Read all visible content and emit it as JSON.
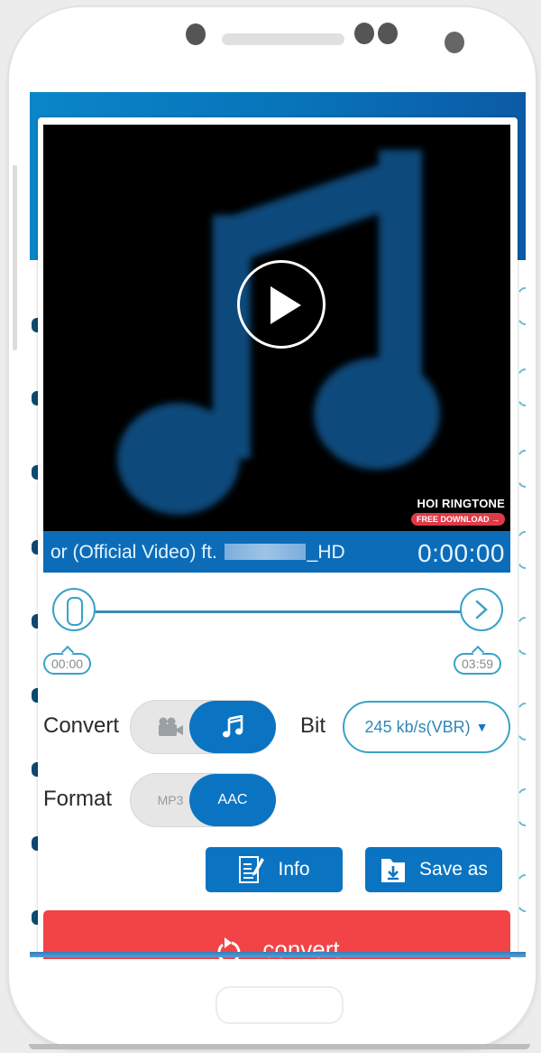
{
  "device": {
    "frame": "android-phone"
  },
  "player": {
    "play_icon": "play-icon",
    "artwork_icon": "music-note-icon",
    "watermark": {
      "name": "HOI RINGTONE",
      "cta": "FREE DOWNLOAD →"
    },
    "title_prefix": "or (Official Video) ft.",
    "title_suffix": "_HD",
    "current_time": "0:00:00"
  },
  "trim": {
    "start_label": "00:00",
    "end_label": "03:59",
    "start_fraction": 0.0,
    "end_fraction": 1.0
  },
  "convert_mode": {
    "label": "Convert",
    "options": [
      {
        "icon": "video-camera-icon",
        "selected": false
      },
      {
        "icon": "music-note-icon",
        "selected": true
      }
    ]
  },
  "format": {
    "label": "Format",
    "options": [
      {
        "label": "MP3",
        "selected": false
      },
      {
        "label": "AAC",
        "selected": true
      }
    ]
  },
  "bitrate": {
    "label": "Bit",
    "value": "245 kb/s(VBR)",
    "caret": "▼"
  },
  "actions": {
    "info_label": "Info",
    "save_as_label": "Save as",
    "convert_label": "convert"
  },
  "colors": {
    "primary": "#0b74c2",
    "accent_outline": "#3aa2c8",
    "convert_red": "#f24346"
  }
}
